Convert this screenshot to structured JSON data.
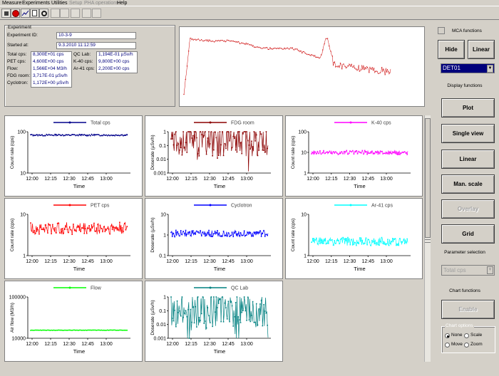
{
  "menu": {
    "items": [
      "Measure",
      "Experiments",
      "Utilities",
      "Setup",
      "PHA operations",
      "Help"
    ]
  },
  "toolbar": {
    "icons": [
      "square-icon",
      "stop-icon",
      "chart-icon",
      "page-icon",
      "refresh-icon",
      "save-icon",
      "wrench-icon",
      "pha-icon",
      "print-icon",
      "copy-icon"
    ]
  },
  "experiment": {
    "group_label": "Experiment",
    "id_label": "Experiment ID:",
    "id_value": "10-3-9",
    "started_label": "Started at:",
    "started_value": "9.3.2010 11:12:59",
    "rows_left": [
      {
        "label": "Total cps:",
        "value": "8,300E+01 cps"
      },
      {
        "label": "PET cps:",
        "value": "4,600E+00 cps"
      },
      {
        "label": "Flow:",
        "value": "1,566E+04 M3/h"
      },
      {
        "label": "FDG room:",
        "value": "3,717E-01 µSv/h"
      },
      {
        "label": "Cyclotron:",
        "value": "1,172E+00 µSv/h"
      }
    ],
    "rows_right": [
      {
        "label": "QC Lab:",
        "value": "1,194E-01 µSv/h"
      },
      {
        "label": "K-40 cps:",
        "value": "9,800E+00 cps"
      },
      {
        "label": "Ar-41 cps:",
        "value": "2,200E+00 cps"
      }
    ]
  },
  "sidebar": {
    "mca_label": "MCA functions",
    "hide_label": "Hide",
    "linear_label": "Linear",
    "detector_value": "DET01",
    "display_label": "Display functions",
    "plot_label": "Plot",
    "single_view_label": "Single view",
    "linear2_label": "Linear",
    "man_scale_label": "Man. scale",
    "overlay_label": "Overlay",
    "grid_label": "Grid",
    "param_label": "Parameter selection",
    "param_value": "Total cps",
    "chart_func_label": "Chart functions",
    "enable_label": "Enable",
    "chart_options_label": "Chart options",
    "radio": [
      {
        "label": "None",
        "checked": true
      },
      {
        "label": "Scale",
        "checked": false
      },
      {
        "label": "Move",
        "checked": false
      },
      {
        "label": "Zoom",
        "checked": false
      }
    ]
  },
  "colors": {
    "total": "#00008b",
    "fdg": "#8b0000",
    "k40": "#ff00ff",
    "pet": "#ff0000",
    "cyclotron": "#0000ff",
    "ar41": "#00ffff",
    "flow": "#00ff00",
    "qclab": "#008080",
    "spectrum": "#cc0000"
  },
  "chart_data": [
    {
      "id": "total",
      "type": "line",
      "title": "Total cps",
      "ylabel": "Count rate (cps)",
      "xlabel": "Time",
      "xticks": [
        "12:00",
        "12:15",
        "12:30",
        "12:45",
        "13:00"
      ],
      "yticks": [
        "100",
        "10"
      ],
      "scale": "log",
      "ylim": [
        10,
        100
      ],
      "series": [
        {
          "name": "Total cps",
          "level": 83,
          "noise": 0.02
        }
      ]
    },
    {
      "id": "fdg",
      "type": "line",
      "title": "FDG room",
      "ylabel": "Doserate (µSv/h)",
      "xlabel": "Time",
      "xticks": [
        "12:00",
        "12:15",
        "12:30",
        "12:45",
        "13:00"
      ],
      "yticks": [
        "1",
        "0.1",
        "0.01",
        "0.001"
      ],
      "scale": "log",
      "ylim": [
        0.001,
        1
      ],
      "series": [
        {
          "name": "FDG room",
          "level": 0.37,
          "noise": 0.45
        }
      ]
    },
    {
      "id": "k40",
      "type": "line",
      "title": "K-40 cps",
      "ylabel": "Count rate (cps)",
      "xlabel": "Time",
      "xticks": [
        "12:00",
        "12:15",
        "12:30",
        "12:45",
        "13:00"
      ],
      "yticks": [
        "100",
        "10",
        "1"
      ],
      "scale": "log",
      "ylim": [
        1,
        100
      ],
      "series": [
        {
          "name": "K-40 cps",
          "level": 9.8,
          "noise": 0.05
        }
      ]
    },
    {
      "id": "pet",
      "type": "line",
      "title": "PET cps",
      "ylabel": "Count rate (cps)",
      "xlabel": "Time",
      "xticks": [
        "12:00",
        "12:15",
        "12:30",
        "12:45",
        "13:00"
      ],
      "yticks": [
        "10",
        "1"
      ],
      "scale": "log",
      "ylim": [
        1,
        10
      ],
      "series": [
        {
          "name": "PET cps",
          "level": 4.6,
          "noise": 0.15
        }
      ]
    },
    {
      "id": "cyclotron",
      "type": "line",
      "title": "Cyclotron",
      "ylabel": "Doserate (µSv/h)",
      "xlabel": "Time",
      "xticks": [
        "12:00",
        "12:15",
        "12:30",
        "12:45",
        "13:00"
      ],
      "yticks": [
        "10",
        "1",
        "0.1"
      ],
      "scale": "log",
      "ylim": [
        0.1,
        10
      ],
      "series": [
        {
          "name": "Cyclotron",
          "level": 1.17,
          "noise": 0.08
        }
      ]
    },
    {
      "id": "ar41",
      "type": "line",
      "title": "Ar-41 cps",
      "ylabel": "Count rate (cps)",
      "xlabel": "Time",
      "xticks": [
        "12:00",
        "12:15",
        "12:30",
        "12:45",
        "13:00"
      ],
      "yticks": [
        "10",
        "1"
      ],
      "scale": "log",
      "ylim": [
        1,
        10
      ],
      "series": [
        {
          "name": "Ar-41 cps",
          "level": 2.2,
          "noise": 0.1
        }
      ]
    },
    {
      "id": "flow",
      "type": "line",
      "title": "Flow",
      "ylabel": "Air flow (M3/h)",
      "xlabel": "Time",
      "xticks": [
        "12:00",
        "12:15",
        "12:30",
        "12:45",
        "13:00"
      ],
      "yticks": [
        "100000",
        "10000"
      ],
      "scale": "log",
      "ylim": [
        10000,
        100000
      ],
      "series": [
        {
          "name": "Flow",
          "level": 15660,
          "noise": 0.005
        }
      ]
    },
    {
      "id": "qclab",
      "type": "line",
      "title": "QC Lab",
      "ylabel": "Doserate (µSv/h)",
      "xlabel": "Time",
      "xticks": [
        "12:00",
        "12:15",
        "12:30",
        "12:45",
        "13:00"
      ],
      "yticks": [
        "1",
        "0.1",
        "0.01",
        "0.001"
      ],
      "scale": "log",
      "ylim": [
        0.001,
        1
      ],
      "series": [
        {
          "name": "QC Lab",
          "level": 0.12,
          "noise": 0.45
        }
      ]
    }
  ]
}
